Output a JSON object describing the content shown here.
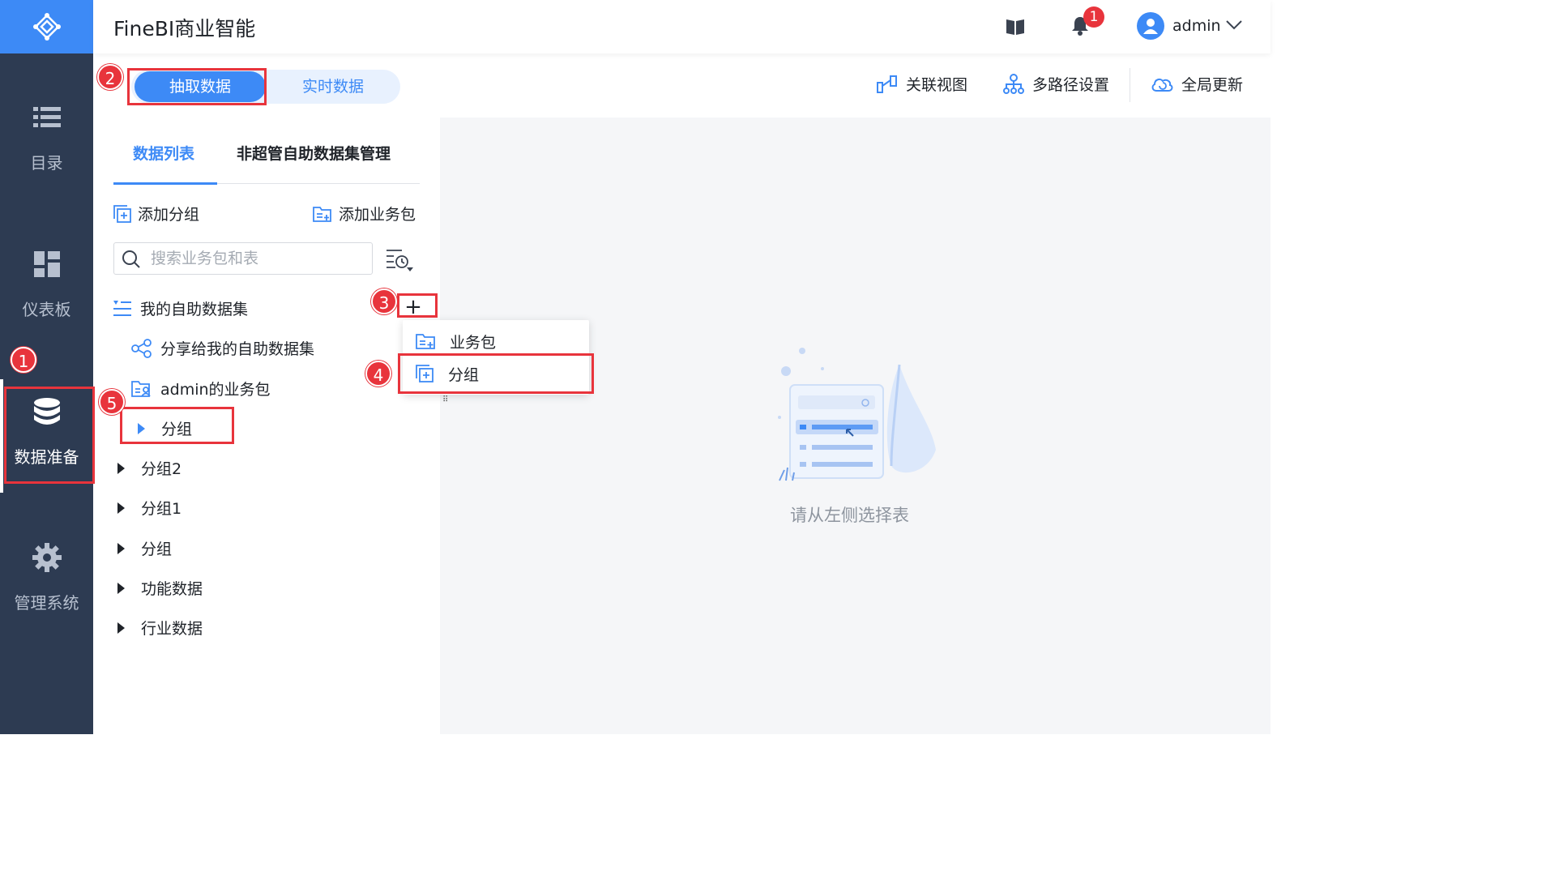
{
  "header": {
    "title": "FineBI商业智能",
    "notification_count": "1",
    "username": "admin"
  },
  "nav": {
    "items": [
      {
        "label": "目录",
        "icon": "list-icon"
      },
      {
        "label": "仪表板",
        "icon": "dashboard-icon"
      },
      {
        "label": "数据准备",
        "icon": "database-icon",
        "active": true
      },
      {
        "label": "管理系统",
        "icon": "gear-icon"
      }
    ]
  },
  "mode_toggle": {
    "extract_label": "抽取数据",
    "realtime_label": "实时数据",
    "selected": "抽取数据"
  },
  "toolbar": {
    "relation_view": "关联视图",
    "multipath": "多路径设置",
    "global_update": "全局更新"
  },
  "panel": {
    "tabs": [
      "数据列表",
      "非超管自助数据集管理"
    ],
    "add_group": "添加分组",
    "add_package": "添加业务包",
    "search_placeholder": "搜索业务包和表"
  },
  "tree": {
    "my_dataset": "我的自助数据集",
    "shared_dataset": "分享给我的自助数据集",
    "admin_package": "admin的业务包",
    "new_group": "分组",
    "groups": [
      "分组2",
      "分组1",
      "分组",
      "功能数据",
      "行业数据"
    ]
  },
  "dropdown": {
    "items": [
      "业务包",
      "分组"
    ]
  },
  "empty_state": {
    "text": "请从左侧选择表"
  },
  "callouts": [
    "1",
    "2",
    "3",
    "4",
    "5"
  ],
  "colors": {
    "accent": "#3d8af6",
    "nav_bg": "#2d3b52",
    "highlight": "#e8343c"
  }
}
